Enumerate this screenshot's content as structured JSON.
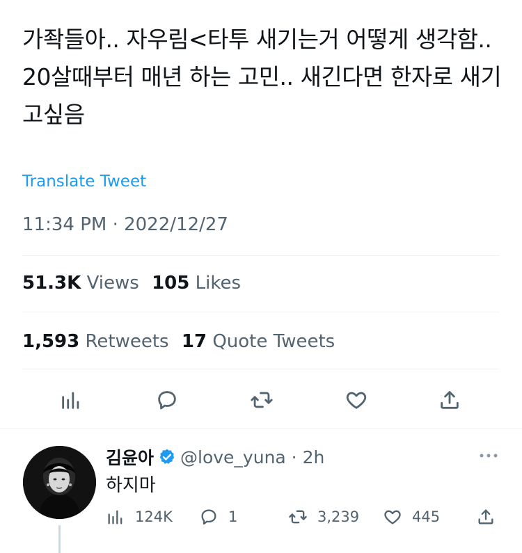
{
  "tweet": {
    "text": "가좍들아.. 자우림<타투 새기는거 어떻게 생각함.. 20살때부터 매년 하는 고민.. 새긴다면 한자로 새기고싶음",
    "translate_label": "Translate Tweet",
    "timestamp": "11:34 PM · 2022/12/27",
    "views_count": "51.3K",
    "views_label": "Views",
    "likes_count": "105",
    "likes_label": "Likes",
    "retweets_count": "1,593",
    "retweets_label": "Retweets",
    "quotes_count": "17",
    "quotes_label": "Quote Tweets"
  },
  "icons": {
    "actions": [
      "analytics-icon",
      "reply-icon",
      "retweet-icon",
      "like-icon",
      "share-icon"
    ],
    "color": "#536471"
  },
  "reply": {
    "name": "김윤아",
    "handle_time": "@love_yuna · 2h",
    "text": "하지마",
    "views": "124K",
    "replies": "1",
    "retweets": "3,239",
    "likes": "445",
    "verified_color": "#1d9bf0"
  }
}
